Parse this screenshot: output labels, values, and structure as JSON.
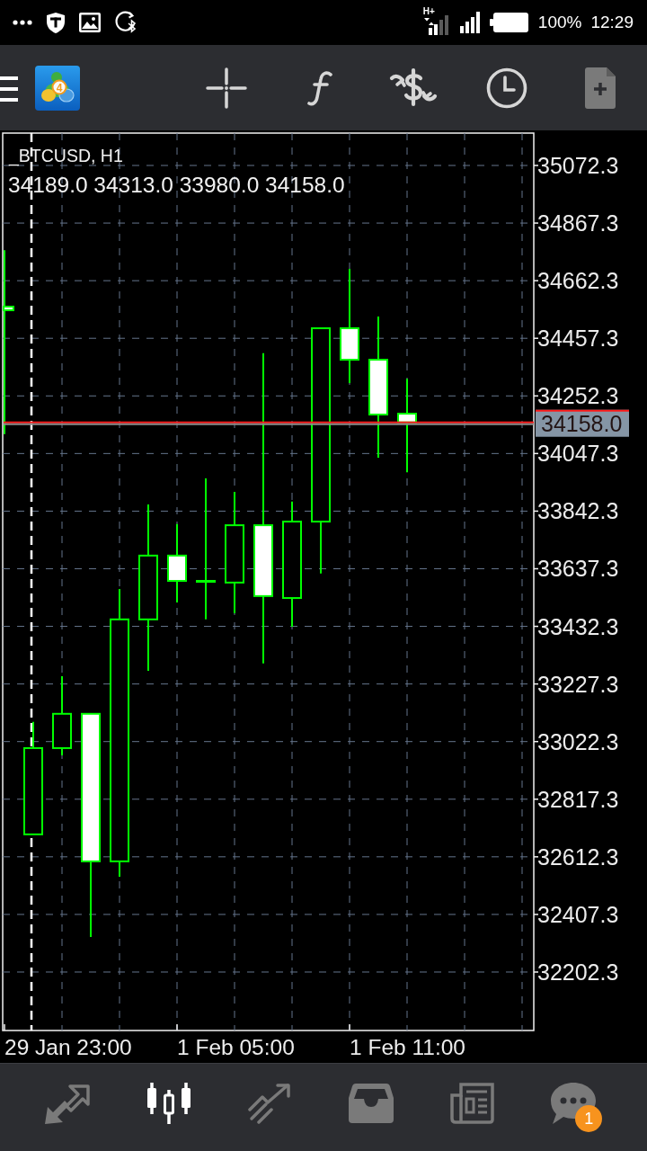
{
  "status_bar": {
    "network_type": "H+",
    "battery": "100%",
    "time": "12:29"
  },
  "toolbar": {
    "logo_text": "4"
  },
  "chart": {
    "symbol": "_BTCUSD, H1",
    "ohlc": "34189.0 34313.0 33980.0 34158.0",
    "price_labels": [
      "35072.3",
      "34867.3",
      "34662.3",
      "34457.3",
      "34252.3",
      "34047.3",
      "33842.3",
      "33637.3",
      "33432.3",
      "33227.3",
      "33022.3",
      "32817.3",
      "32612.3",
      "32407.3",
      "32202.3"
    ],
    "current_price": "34158.0",
    "time_labels": [
      "29 Jan 23:00",
      "1 Feb 05:00",
      "1 Feb 11:00"
    ]
  },
  "bottom_nav": {
    "items": [
      {
        "selected": false
      },
      {
        "selected": true
      },
      {
        "selected": false
      },
      {
        "selected": false
      },
      {
        "selected": false
      },
      {
        "selected": false,
        "badge": "1"
      }
    ]
  }
}
